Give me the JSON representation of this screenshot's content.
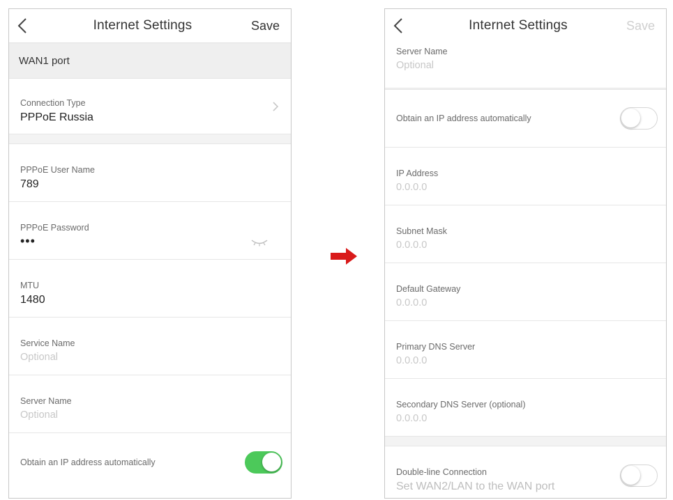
{
  "left_screen": {
    "nav": {
      "back_icon": "chevron-left-icon",
      "title": "Internet Settings",
      "save_label": "Save"
    },
    "section_title": "WAN1 port",
    "connection_type": {
      "label": "Connection Type",
      "value": "PPPoE Russia",
      "icon": "chevron-right-icon"
    },
    "pppoe_user": {
      "label": "PPPoE User Name",
      "value": "789"
    },
    "pppoe_password": {
      "label": "PPPoE Password",
      "value": "•••",
      "icon": "eye-closed-icon"
    },
    "mtu": {
      "label": "MTU",
      "value": "1480"
    },
    "service_name": {
      "label": "Service Name",
      "placeholder": "Optional"
    },
    "server_name": {
      "label": "Server Name",
      "placeholder": "Optional"
    },
    "obtain_ip": {
      "label": "Obtain an IP address automatically",
      "toggle_on": true
    }
  },
  "right_screen": {
    "nav": {
      "back_icon": "chevron-left-icon",
      "title": "Internet Settings",
      "save_label": "Save",
      "save_enabled": false
    },
    "server_name": {
      "label": "Server Name",
      "placeholder": "Optional"
    },
    "obtain_ip": {
      "label": "Obtain an IP address automatically",
      "toggle_on": false
    },
    "ip_address": {
      "label": "IP Address",
      "placeholder": "0.0.0.0"
    },
    "subnet_mask": {
      "label": "Subnet Mask",
      "placeholder": "0.0.0.0"
    },
    "default_gateway": {
      "label": "Default Gateway",
      "placeholder": "0.0.0.0"
    },
    "primary_dns": {
      "label": "Primary DNS Server",
      "placeholder": "0.0.0.0"
    },
    "secondary_dns": {
      "label": "Secondary DNS Server (optional)",
      "placeholder": "0.0.0.0"
    },
    "double_line": {
      "label": "Double-line Connection",
      "sublabel": "Set WAN2/LAN to the WAN port",
      "toggle_on": false
    }
  },
  "colors": {
    "arrow": "#d91a1a",
    "toggle_on": "#4cc95a",
    "section_bg": "#efefef"
  },
  "transition_icon": "right-arrow-icon"
}
